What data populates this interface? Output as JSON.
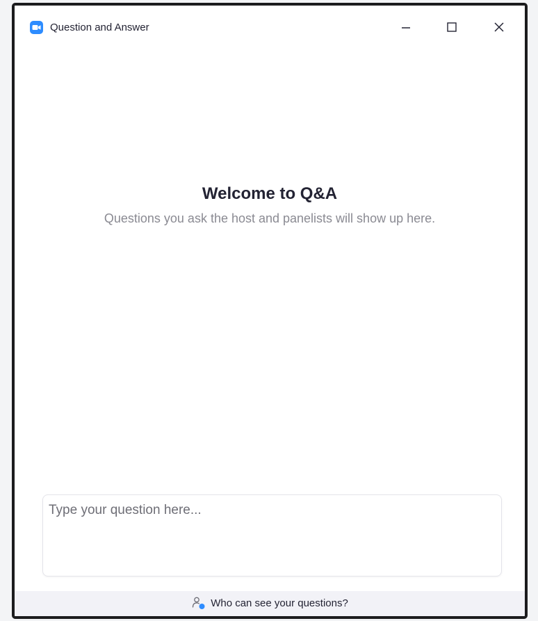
{
  "window": {
    "title": "Question and Answer",
    "app_icon": "zoom-camera-icon",
    "controls": {
      "minimize": "minimize-icon",
      "maximize": "maximize-icon",
      "close": "close-icon"
    }
  },
  "empty_state": {
    "title": "Welcome to Q&A",
    "subtitle": "Questions you ask the host and panelists will show up here."
  },
  "question_input": {
    "placeholder": "Type your question here...",
    "value": ""
  },
  "footer": {
    "privacy_link": "Who can see your questions?",
    "icon": "person-eye-icon"
  },
  "colors": {
    "accent": "#2d8cff",
    "title_text": "#232333",
    "muted_text": "#8a8a92",
    "footer_bg": "#f2f2f7"
  }
}
